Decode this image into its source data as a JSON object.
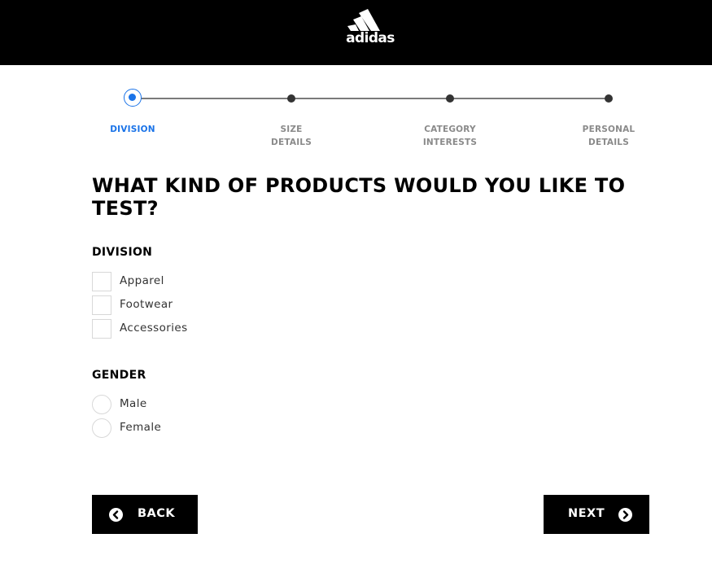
{
  "header": {
    "brand": "adidas",
    "background": "#000000"
  },
  "stepper": {
    "accent": "#1a73e8",
    "steps": [
      {
        "line1": "DIVISION",
        "line2": "",
        "active": true
      },
      {
        "line1": "SIZE",
        "line2": "DETAILS",
        "active": false
      },
      {
        "line1": "CATEGORY",
        "line2": "INTERESTS",
        "active": false
      },
      {
        "line1": "PERSONAL",
        "line2": "DETAILS",
        "active": false
      }
    ]
  },
  "question": "WHAT KIND OF PRODUCTS WOULD YOU LIKE TO TEST?",
  "division": {
    "title": "DIVISION",
    "options": [
      {
        "label": "Apparel",
        "checked": false
      },
      {
        "label": "Footwear",
        "checked": false
      },
      {
        "label": "Accessories",
        "checked": false
      }
    ]
  },
  "gender": {
    "title": "GENDER",
    "options": [
      {
        "label": "Male",
        "selected": false
      },
      {
        "label": "Female",
        "selected": false
      }
    ]
  },
  "buttons": {
    "back_label": "BACK",
    "back_icon": "chevron-left-circle-icon",
    "next_label": "NEXT",
    "next_icon": "chevron-right-circle-icon"
  }
}
